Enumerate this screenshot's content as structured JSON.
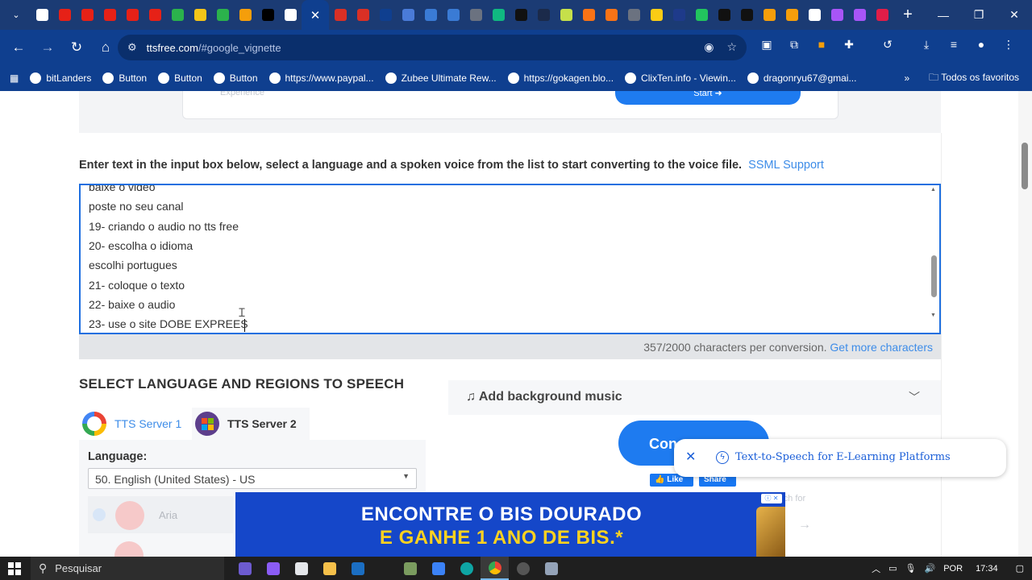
{
  "browser": {
    "url_host": "ttsfree.com",
    "url_path": "/#google_vignette",
    "active_tab_close": "✕",
    "bookmarks": [
      {
        "label": "bitLanders"
      },
      {
        "label": "Button"
      },
      {
        "label": "Button"
      },
      {
        "label": "Button"
      },
      {
        "label": "https://www.paypal..."
      },
      {
        "label": "Zubee Ultimate Rew..."
      },
      {
        "label": "https://gokagen.blo..."
      },
      {
        "label": "ClixTen.info - Viewin..."
      },
      {
        "label": "dragonryu67@gmai..."
      }
    ],
    "bookmarks_overflow": "»",
    "all_bookmarks": "Todos os favoritos",
    "tab_favicon_colors": [
      "#ffffff",
      "#e62117",
      "#e62117",
      "#e62117",
      "#e62117",
      "#e62117",
      "#2bb24c",
      "#f5c518",
      "#2bb24c",
      "#f59e0b",
      "#000000",
      "#ffffff",
      "#d93025",
      "#d93025",
      "#0f3f8f",
      "#4a7bd8",
      "#3a7bd5",
      "#3a7bd5",
      "#6b7280",
      "#10b981",
      "#111111",
      "#1b2a4a",
      "#c6e04a",
      "#f97316",
      "#f97316",
      "#6b7280",
      "#facc15",
      "#1e3a8a",
      "#22c55e",
      "#111111",
      "#111111",
      "#f59e0b",
      "#f59e0b",
      "#ffffff",
      "#a855f7",
      "#a855f7",
      "#e11d48"
    ]
  },
  "page": {
    "top_ghost_text": "Experience",
    "top_cta_text": "Start ➜",
    "instructions": "Enter text in the input box below, select a language and a spoken voice from the list to start converting to the voice file.",
    "ssml_link": "SSML Support",
    "editor_lines": [
      "baixe o video",
      "poste no seu canal",
      "19- criando o audio no tts free",
      "20- escolha o idioma",
      "escolhi portugues",
      "21- coloque o texto",
      "22- baixe o audio",
      "23- use o site DOBE EXPREES"
    ],
    "counter_text": "357/2000 characters per conversion.",
    "more_chars_link": "Get more characters",
    "section_title": "SELECT LANGUAGE AND REGIONS TO SPEECH",
    "server_tabs": [
      {
        "label": "TTS Server 1"
      },
      {
        "label": "TTS Server 2"
      }
    ],
    "language_label": "Language:",
    "language_selected": "50. English (United States) - US",
    "voice_name": "Aria",
    "music_label": "Add background music",
    "convert_label": "Con",
    "fb_like": "Like",
    "fb_share": "Share",
    "search_ghost": "rch for",
    "popup_text": "Text-to-Speech for E-Learning Platforms",
    "ad_line1": "ENCONTRE O BIS DOURADO",
    "ad_line2": "E GANHE 1 ANO DE BIS.*"
  },
  "taskbar": {
    "search_placeholder": "Pesquisar",
    "language": "POR",
    "time": "17:34"
  }
}
